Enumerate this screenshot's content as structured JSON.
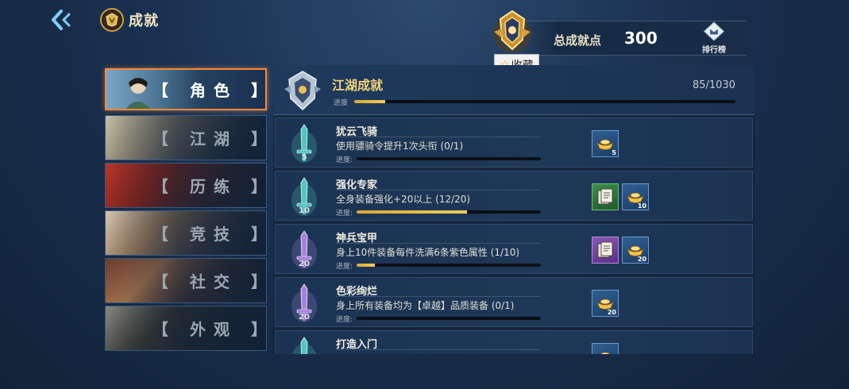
{
  "header": {
    "title": "成就",
    "points_label": "总成就点",
    "points_value": "300",
    "rank_label": "排行榜",
    "tooltip": "收藏"
  },
  "tabs": [
    {
      "label": "【 角色 】",
      "active": true
    },
    {
      "label": "【 江湖 】",
      "active": false
    },
    {
      "label": "【 历练 】",
      "active": false
    },
    {
      "label": "【 竞技 】",
      "active": false
    },
    {
      "label": "【 社交 】",
      "active": false
    },
    {
      "label": "【 外观 】",
      "active": false
    }
  ],
  "summary": {
    "title": "江湖成就",
    "count": "85/1030",
    "progress_label": "进度",
    "progress": 0.082
  },
  "achievements": [
    {
      "title": "犹云飞骑",
      "desc": "使用骠骑令提升1次头衔 (0/1)",
      "progress_label": "进度:",
      "progress": 0.0,
      "points": "5",
      "sword_color": "teal",
      "rewards": [
        {
          "icon": "gold-ingot",
          "color": "blue",
          "count": "5"
        }
      ]
    },
    {
      "title": "强化专家",
      "desc": "全身装备强化+20以上 (12/20)",
      "progress_label": "进度:",
      "progress": 0.6,
      "points": "10",
      "sword_color": "teal",
      "rewards": [
        {
          "icon": "book",
          "color": "green",
          "count": ""
        },
        {
          "icon": "gold-ingot",
          "color": "blue",
          "count": "10"
        }
      ]
    },
    {
      "title": "神兵宝甲",
      "desc": "身上10件装备每件洗满6条紫色属性 (1/10)",
      "progress_label": "进度:",
      "progress": 0.1,
      "points": "20",
      "sword_color": "purple",
      "rewards": [
        {
          "icon": "book",
          "color": "purple",
          "count": ""
        },
        {
          "icon": "gold-ingot",
          "color": "blue",
          "count": "20"
        }
      ]
    },
    {
      "title": "色彩绚烂",
      "desc": "身上所有装备均为【卓越】品质装备 (0/1)",
      "progress_label": "进度:",
      "progress": 0.0,
      "points": "20",
      "sword_color": "purple",
      "rewards": [
        {
          "icon": "gold-ingot",
          "color": "blue",
          "count": "20"
        }
      ]
    },
    {
      "title": "打造入门",
      "desc": "",
      "progress_label": "",
      "progress": 0.0,
      "points": "",
      "sword_color": "teal",
      "rewards": [
        {
          "icon": "gold-ingot",
          "color": "blue",
          "count": ""
        }
      ]
    }
  ],
  "colors": {
    "accent_gold": "#f2cc5a",
    "active_border": "#f08a3c",
    "teal_sword": "#4fc7c0",
    "purple_sword": "#a880e0"
  }
}
